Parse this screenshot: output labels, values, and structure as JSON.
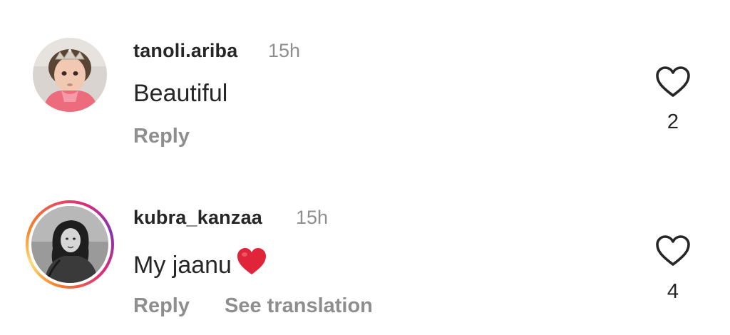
{
  "comments": [
    {
      "username": "tanoli.ariba",
      "time": "15h",
      "text": "Beautiful",
      "reply_label": "Reply",
      "likes": "2",
      "avatar_icon": "child-with-tiara-avatar",
      "has_story_ring": false
    },
    {
      "username": "kubra_kanzaa",
      "time": "15h",
      "text": "My jaanu",
      "emoji": "red-heart-icon",
      "reply_label": "Reply",
      "see_translation_label": "See translation",
      "likes": "4",
      "avatar_icon": "woman-bw-portrait-avatar",
      "has_story_ring": true
    }
  ],
  "colors": {
    "text_primary": "#262626",
    "text_secondary": "#8e8e8e",
    "heart_emoji": "#e0243a"
  }
}
